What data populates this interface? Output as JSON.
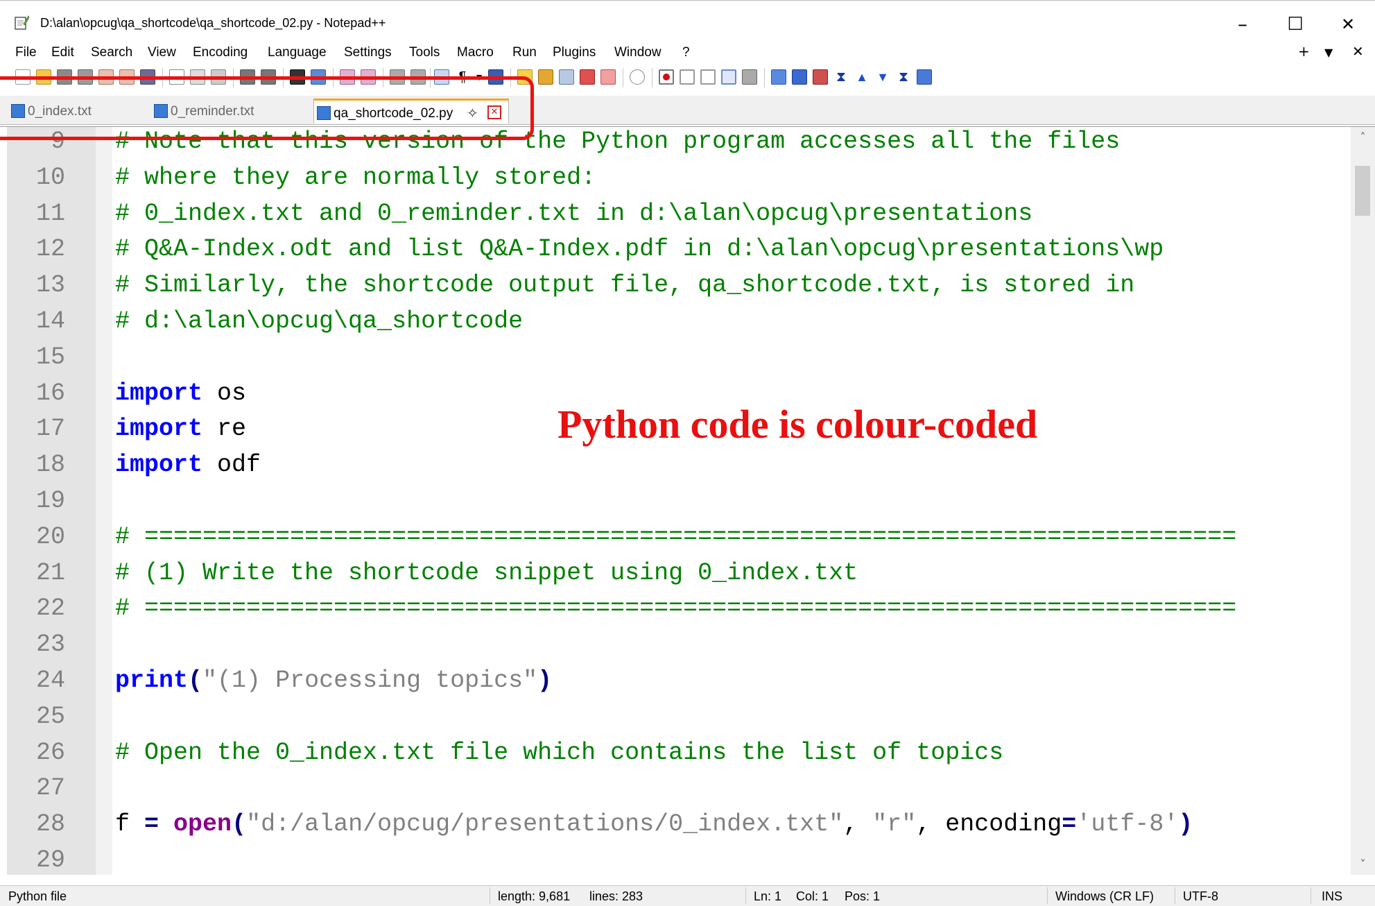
{
  "window": {
    "title": "D:\\alan\\opcug\\qa_shortcode\\qa_shortcode_02.py - Notepad++",
    "minimize": "–",
    "maximize": "☐",
    "close": "✕"
  },
  "menu": {
    "items": [
      "File",
      "Edit",
      "Search",
      "View",
      "Encoding",
      "Language",
      "Settings",
      "Tools",
      "Macro",
      "Run",
      "Plugins",
      "Window",
      "?"
    ],
    "right_plus": "+",
    "right_down": "▼",
    "right_close": "✕"
  },
  "tabs": [
    {
      "label": "0_index.txt"
    },
    {
      "label": "0_reminder.txt"
    },
    {
      "label": "qa_shortcode_02.py"
    }
  ],
  "tab_icons": {
    "pin": "✧",
    "close": "✕"
  },
  "editor": {
    "lines": [
      {
        "n": "9",
        "tokens": [
          {
            "t": "# Note that this version of the Python program accesses all the files",
            "c": "cm"
          }
        ]
      },
      {
        "n": "10",
        "tokens": [
          {
            "t": "# where they are normally stored:",
            "c": "cm"
          }
        ]
      },
      {
        "n": "11",
        "tokens": [
          {
            "t": "# 0_index.txt and 0_reminder.txt in d:\\alan\\opcug\\presentations",
            "c": "cm"
          }
        ]
      },
      {
        "n": "12",
        "tokens": [
          {
            "t": "# Q&A-Index.odt and list Q&A-Index.pdf in d:\\alan\\opcug\\presentations\\wp",
            "c": "cm"
          }
        ]
      },
      {
        "n": "13",
        "tokens": [
          {
            "t": "# Similarly, the shortcode output file, qa_shortcode.txt, is stored in",
            "c": "cm"
          }
        ]
      },
      {
        "n": "14",
        "tokens": [
          {
            "t": "# d:\\alan\\opcug\\qa_shortcode",
            "c": "cm"
          }
        ]
      },
      {
        "n": "15",
        "tokens": []
      },
      {
        "n": "16",
        "tokens": [
          {
            "t": "import",
            "c": "kw"
          },
          {
            "t": " os",
            "c": ""
          }
        ]
      },
      {
        "n": "17",
        "tokens": [
          {
            "t": "import",
            "c": "kw"
          },
          {
            "t": " re",
            "c": ""
          }
        ]
      },
      {
        "n": "18",
        "tokens": [
          {
            "t": "import",
            "c": "kw"
          },
          {
            "t": " odf",
            "c": ""
          }
        ]
      },
      {
        "n": "19",
        "tokens": []
      },
      {
        "n": "20",
        "tokens": [
          {
            "t": "# ===========================================================================",
            "c": "cm"
          }
        ]
      },
      {
        "n": "21",
        "tokens": [
          {
            "t": "# (1) Write the shortcode snippet using 0_index.txt",
            "c": "cm"
          }
        ]
      },
      {
        "n": "22",
        "tokens": [
          {
            "t": "# ===========================================================================",
            "c": "cm"
          }
        ]
      },
      {
        "n": "23",
        "tokens": []
      },
      {
        "n": "24",
        "tokens": [
          {
            "t": "print",
            "c": "kw"
          },
          {
            "t": "(",
            "c": "op"
          },
          {
            "t": "\"(1) Processing topics\"",
            "c": "st"
          },
          {
            "t": ")",
            "c": "op"
          }
        ]
      },
      {
        "n": "25",
        "tokens": []
      },
      {
        "n": "26",
        "tokens": [
          {
            "t": "# Open the 0_index.txt file which contains the list of topics",
            "c": "cm"
          }
        ]
      },
      {
        "n": "27",
        "tokens": []
      },
      {
        "n": "28",
        "tokens": [
          {
            "t": "f ",
            "c": ""
          },
          {
            "t": "=",
            "c": "op"
          },
          {
            "t": " ",
            "c": ""
          },
          {
            "t": "open",
            "c": "bi"
          },
          {
            "t": "(",
            "c": "op"
          },
          {
            "t": "\"d:/alan/opcug/presentations/0_index.txt\"",
            "c": "st"
          },
          {
            "t": ", ",
            "c": ""
          },
          {
            "t": "\"r\"",
            "c": "st"
          },
          {
            "t": ", encoding",
            "c": ""
          },
          {
            "t": "=",
            "c": "op"
          },
          {
            "t": "'utf-8'",
            "c": "st"
          },
          {
            "t": ")",
            "c": "op"
          }
        ]
      },
      {
        "n": "29",
        "tokens": []
      }
    ]
  },
  "annotation": "Python code is colour-coded",
  "scroll": {
    "up": "˄",
    "down": "˅"
  },
  "status": {
    "filetype": "Python file",
    "length": "length: 9,681",
    "lines": "lines: 283",
    "ln": "Ln: 1",
    "col": "Col: 1",
    "pos": "Pos: 1",
    "eol": "Windows (CR LF)",
    "encoding": "UTF-8",
    "mode": "INS"
  },
  "colors": {
    "comment": "#008000",
    "keyword": "#0000ff",
    "builtin": "#880088",
    "string": "#808080",
    "annotation": "#e81010",
    "active_tab_accent": "#f5a623"
  }
}
